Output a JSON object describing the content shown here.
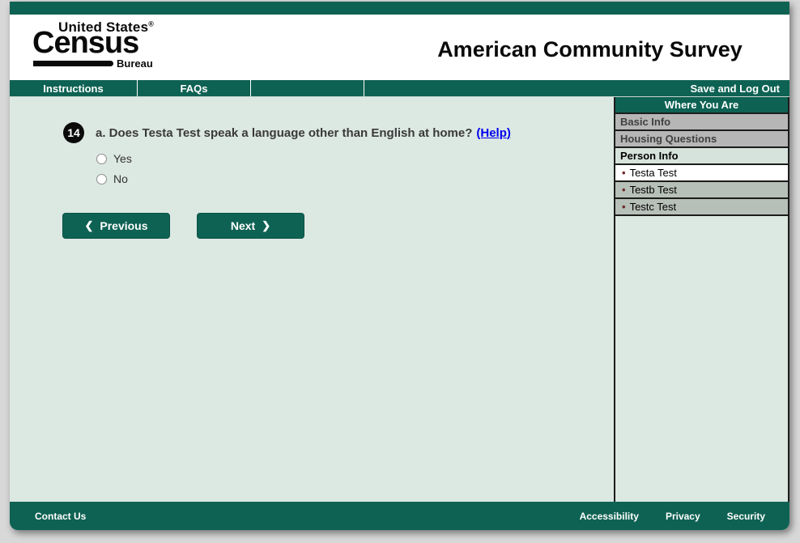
{
  "header": {
    "logo": {
      "line1": "United States",
      "registered": "®",
      "line2": "Census",
      "line3": "Bureau"
    },
    "title": "American Community Survey"
  },
  "navbar": {
    "items": [
      {
        "label": "Instructions"
      },
      {
        "label": "FAQs"
      }
    ],
    "save_logout": "Save and Log Out"
  },
  "question": {
    "number": "14",
    "text": "a. Does Testa Test speak a language other than English at home?",
    "help_label": "(Help)",
    "options": [
      {
        "label": "Yes",
        "selected": false
      },
      {
        "label": "No",
        "selected": false
      }
    ]
  },
  "buttons": {
    "previous_label": "Previous",
    "next_label": "Next",
    "chevron_left": "❮",
    "chevron_right": "❯"
  },
  "sidebar": {
    "title": "Where You Are",
    "bullet": "•",
    "items": [
      {
        "label": "Basic Info",
        "type": "section"
      },
      {
        "label": "Housing Questions",
        "type": "section"
      },
      {
        "label": "Person Info",
        "type": "section-active"
      },
      {
        "label": "Testa Test",
        "type": "person-current"
      },
      {
        "label": "Testb Test",
        "type": "person"
      },
      {
        "label": "Testc Test",
        "type": "person"
      }
    ]
  },
  "footer": {
    "contact": "Contact Us",
    "links": [
      {
        "label": "Accessibility"
      },
      {
        "label": "Privacy"
      },
      {
        "label": "Security"
      }
    ]
  },
  "colors": {
    "accent_green": "#0e6253",
    "content_mint": "#dce8e2",
    "link_blue": "#0000ee",
    "inactive_gray": "#b5b6b5"
  }
}
